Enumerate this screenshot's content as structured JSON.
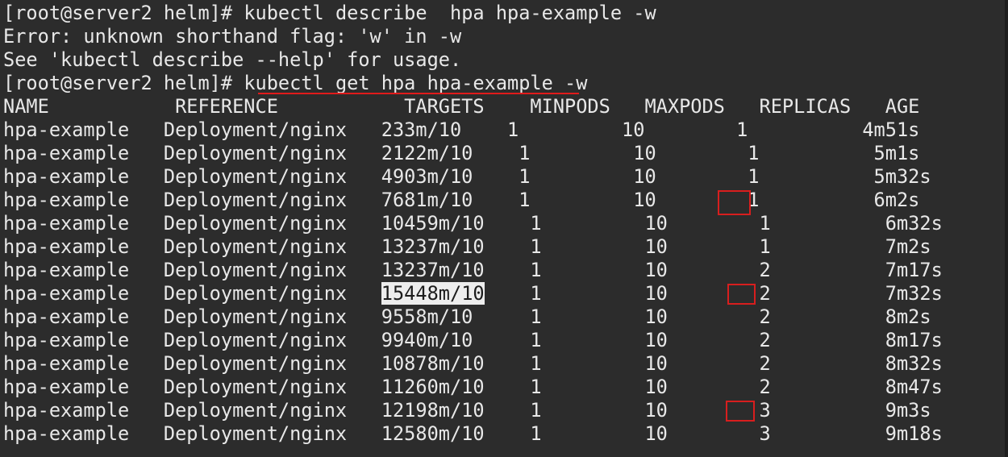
{
  "terminal": {
    "prompt1": "[root@server2 helm]# ",
    "cmd1": "kubectl describe  hpa hpa-example -w",
    "error1": "Error: unknown shorthand flag: 'w' in -w",
    "error2": "See 'kubectl describe --help' for usage.",
    "prompt2": "[root@server2 helm]# ",
    "cmd2": "kubectl get hpa hpa-example -w",
    "header": "NAME           REFERENCE           TARGETS    MINPODS   MAXPODS   REPLICAS   AGE",
    "rows": [
      "hpa-example   Deployment/nginx   233m/10    1         10        1          4m51s",
      "hpa-example   Deployment/nginx   2122m/10    1         10        1          5m1s",
      "hpa-example   Deployment/nginx   4903m/10    1         10        1          5m32s",
      "hpa-example   Deployment/nginx   7681m/10    1         10        1          6m2s",
      "hpa-example   Deployment/nginx   10459m/10    1         10        1          6m32s",
      "hpa-example   Deployment/nginx   13237m/10    1         10        1          7m2s",
      "hpa-example   Deployment/nginx   13237m/10    1         10        2          7m17s",
      "hpa-example   Deployment/nginx   15448m/10    1         10        2          7m32s",
      "hpa-example   Deployment/nginx   9558m/10     1         10        2          8m2s",
      "hpa-example   Deployment/nginx   9940m/10     1         10        2          8m17s",
      "hpa-example   Deployment/nginx   10878m/10    1         10        2          8m32s",
      "hpa-example   Deployment/nginx   11260m/10    1         10        2          8m47s",
      "hpa-example   Deployment/nginx   12198m/10    1         10        3          9m3s",
      "hpa-example   Deployment/nginx   12580m/10    1         10        3          9m18s"
    ],
    "selected_text": "15448m/10",
    "sel_row_prefix": "hpa-example   Deployment/nginx   ",
    "sel_row_suffix": "    1         10        2          7m32s"
  },
  "annotations": {
    "underline_color": "#e01b1b",
    "box_color": "#d81e1e"
  }
}
